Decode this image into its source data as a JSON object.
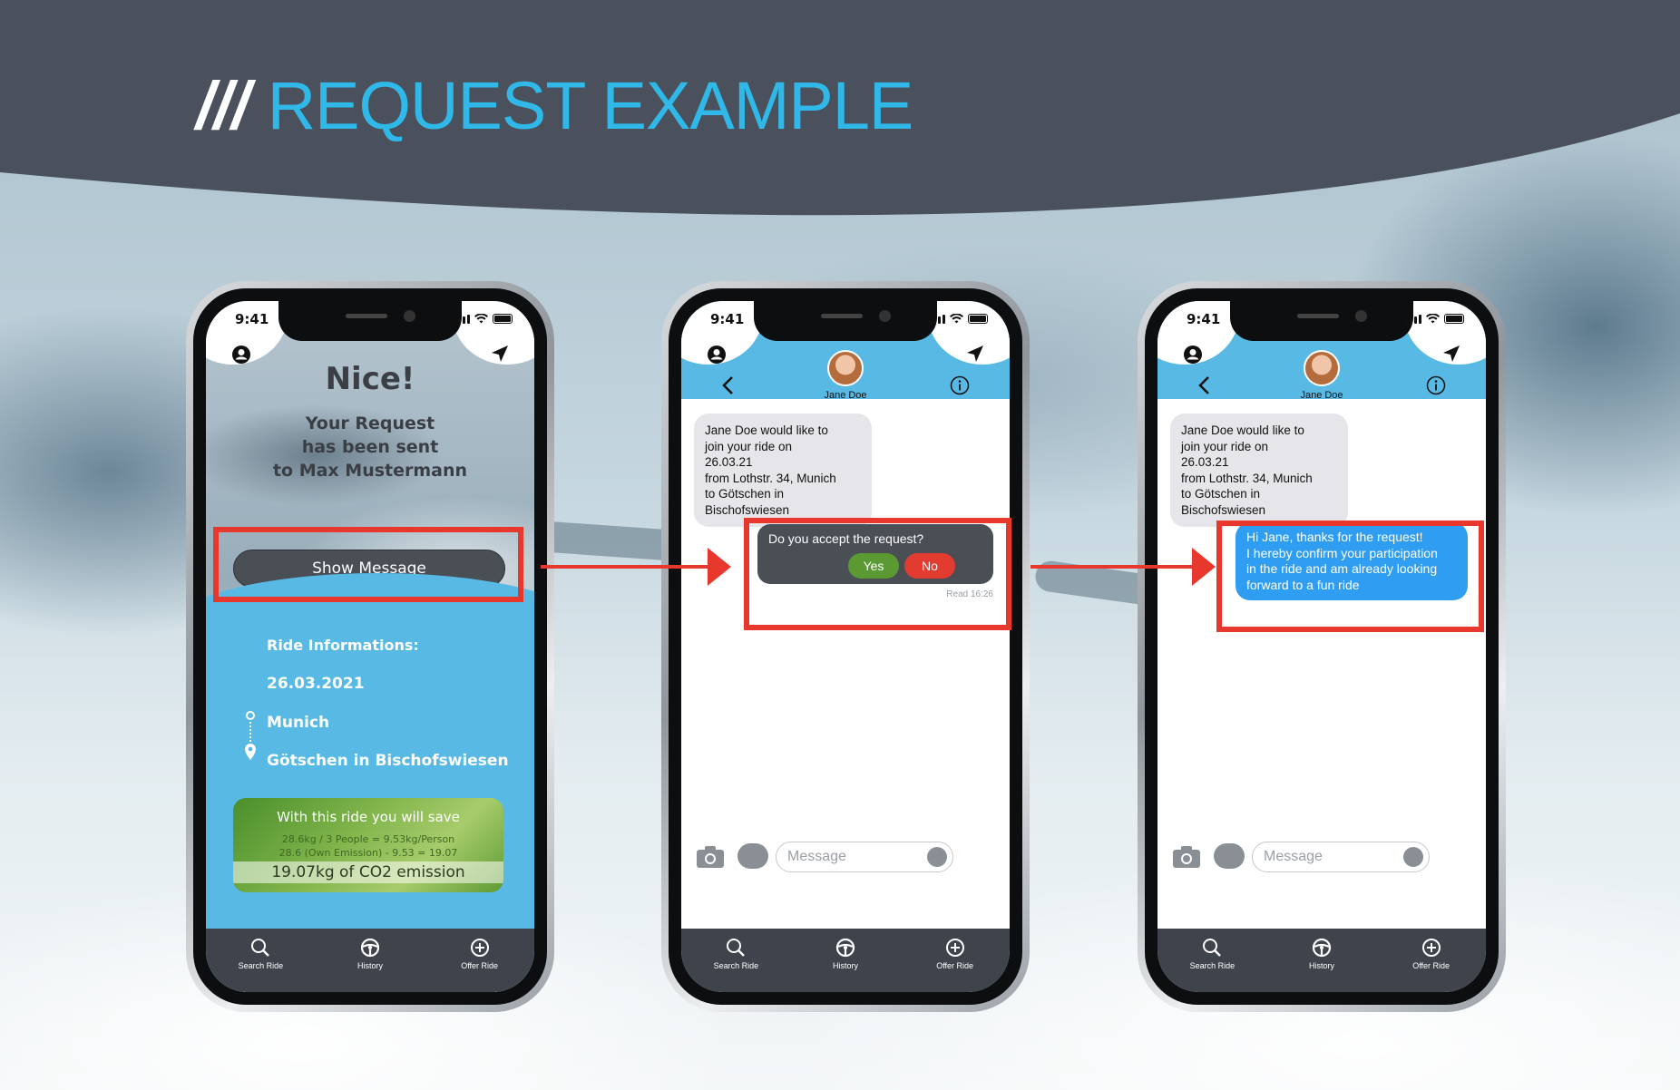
{
  "header": {
    "slashes": "///",
    "title": "REQUEST EXAMPLE"
  },
  "status": {
    "time": "9:41"
  },
  "phone1": {
    "headline": "Nice!",
    "line1": "Your Request",
    "line2": "has been sent",
    "line3": "to Max Mustermann",
    "show_message": "Show Message",
    "ride_info_label": "Ride Informations:",
    "date": "26.03.2021",
    "from": "Munich",
    "to": "Götschen in Bischofswiesen",
    "save_title": "With this ride you will save",
    "save_calc1": "28.6kg / 3 People = 9.53kg/Person",
    "save_calc2": "28.6 (Own Emission) - 9.53 = 19.07",
    "save_result": "19.07kg of CO2 emission"
  },
  "chat": {
    "contact": "Jane Doe",
    "incoming": [
      "Jane Doe would like to",
      "join your ride on",
      "26.03.21",
      "from Lothstr. 34, Munich",
      "to Götschen in",
      "Bischofswiesen"
    ],
    "question": "Do you accept the request?",
    "yes": "Yes",
    "no": "No",
    "read": "Read 16:26",
    "reply": [
      "Hi Jane, thanks for the request!",
      "I hereby confirm your participation",
      "in the ride and am already looking",
      "forward to a fun ride"
    ],
    "placeholder": "Message"
  },
  "tabs": {
    "search": "Search Ride",
    "history": "History",
    "offer": "Offer Ride"
  },
  "colors": {
    "accent": "#2fb8e8",
    "highlight": "#e8382d",
    "header_blue": "#57b9e4",
    "dark": "#4a515c"
  }
}
